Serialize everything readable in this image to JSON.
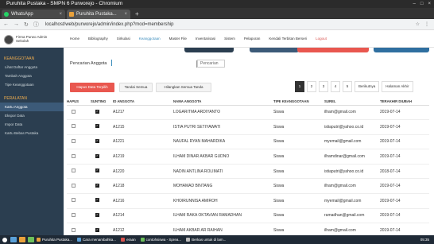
{
  "window": {
    "title": "Puruhita Pustaka - SMPN 6 Purworejo - Chromium",
    "controls": [
      "–",
      "□",
      "×"
    ]
  },
  "tabs": [
    {
      "label": "WhatsApp",
      "close": "×"
    },
    {
      "label": "Puruhita Pustaka...",
      "close": "×"
    }
  ],
  "newtab_symbol": "+",
  "address": {
    "url": "localhost/web/purworejo/admin/index.php?mod=membership"
  },
  "user": {
    "name": "Firma Purwo Admin Sekolah"
  },
  "menu": [
    "Home",
    "Bibliography",
    "Sirkulasi",
    "Keanggotaan",
    "Master File",
    "Inventarisasi",
    "Sistem",
    "Pelaporan",
    "Kendali Terbitan Berseri",
    "Logout"
  ],
  "sidebar": {
    "head1": "KEANGGOTAAN",
    "items1": [
      "Lihat Daftar Anggota",
      "Tambah Anggota",
      "Tipe Keanggotaan"
    ],
    "head2": "PERALATAN",
    "items2": [
      "Kartu Anggota",
      "Ekspor Data",
      "Impor Data",
      "Kartu Bebas Pustaka"
    ]
  },
  "search": {
    "label": "Pencarian Anggota",
    "button": "Pencarian"
  },
  "actions": {
    "delete": "Hapus Data Terpilih",
    "check_all": "Tandai Semua",
    "uncheck_all": "Hilangkan Semua Tanda"
  },
  "pagination": {
    "pages": [
      "1",
      "2",
      "3",
      "4",
      "5"
    ],
    "next": "Berikutnya",
    "last": "Halaman Akhir",
    "current": "1"
  },
  "table": {
    "headers": [
      "HAPUS",
      "SUNTING",
      "ID ANGGOTA",
      "NAMA ANGGOTA",
      "TIPE KEANGGOTAAN",
      "SUREL",
      "TERAKHIR DIUBAH"
    ],
    "rows": [
      {
        "id": "A1217",
        "name": "LOGARITMA ARDIYANTO",
        "type": "Siswa",
        "email": "ilham@gmail.com",
        "date": "2019-07-14"
      },
      {
        "id": "A1215",
        "name": "ISTIA PUTRI SETIYAWATI",
        "type": "Siswa",
        "email": "istiaputri@yahoo.co.id",
        "date": "2019-07-14"
      },
      {
        "id": "A1221",
        "name": "NAUFAL RYAN MAHARDIKA",
        "type": "Siswa",
        "email": "myemail@gmail.com",
        "date": "2019-07-14"
      },
      {
        "id": "A1219",
        "name": "ILHAM DINAR AKBAR GUDNO",
        "type": "Siswa",
        "email": "ilhamdinar@gmail.com",
        "date": "2019-07-14"
      },
      {
        "id": "A1220",
        "name": "NADIN ANTLINA ROLIMATI",
        "type": "Siswa",
        "email": "istiaputri@yahoo.co.id",
        "date": "2018-07-14"
      },
      {
        "id": "A1218",
        "name": "MOHAMAD BINTANG",
        "type": "Siswa",
        "email": "ilham@gmail.com",
        "date": "2019-07-14"
      },
      {
        "id": "A1216",
        "name": "KHOIRUNNISA AMIROH",
        "type": "Siswa",
        "email": "myemail@gmail.com",
        "date": "2019-07-14"
      },
      {
        "id": "A1214",
        "name": "ILHAM RAKA OKTAVIAN RAMADHAN",
        "type": "Siswa",
        "email": "ramadhan@gmail.com",
        "date": "2019-07-14"
      },
      {
        "id": "A1212",
        "name": "ILHAM AKBAR AR RAIHAN",
        "type": "Siswa",
        "email": "ilham@gmail.com",
        "date": "2019-07-14"
      }
    ]
  },
  "taskbar": {
    "items": [
      "Puruhita Pustaka...",
      "Cara menambahka...",
      "eraan",
      "contohsiswa - Sprea...",
      "Berkas untuk di lam..."
    ],
    "clock": "05:35"
  },
  "colors": {
    "sidebar": "#2b3e50",
    "accent": "#3c8dbc",
    "danger": "#e9574f"
  }
}
